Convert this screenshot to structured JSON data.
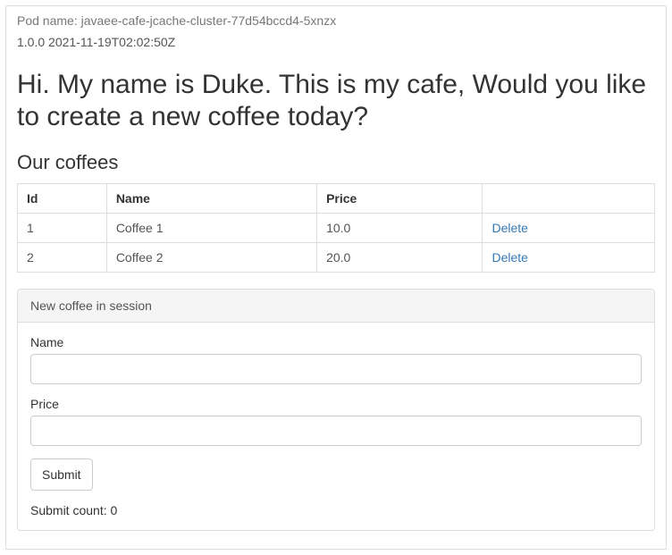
{
  "header": {
    "pod_label": "Pod name:",
    "pod_name": "javaee-cafe-jcache-cluster-77d54bccd4-5xnzx",
    "build_info": "1.0.0 2021-11-19T02:02:50Z"
  },
  "main": {
    "heading": "Hi. My name is Duke. This is my cafe, Would you like to create a new coffee today?",
    "subheading": "Our coffees"
  },
  "table": {
    "headers": {
      "id": "Id",
      "name": "Name",
      "price": "Price",
      "actions": ""
    },
    "delete_label": "Delete",
    "rows": [
      {
        "id": "1",
        "name": "Coffee 1",
        "price": "10.0"
      },
      {
        "id": "2",
        "name": "Coffee 2",
        "price": "20.0"
      }
    ]
  },
  "panel": {
    "title": "New coffee in session",
    "name_label": "Name",
    "name_value": "",
    "price_label": "Price",
    "price_value": "",
    "submit_label": "Submit",
    "submit_count_label": "Submit count:",
    "submit_count_value": "0"
  }
}
